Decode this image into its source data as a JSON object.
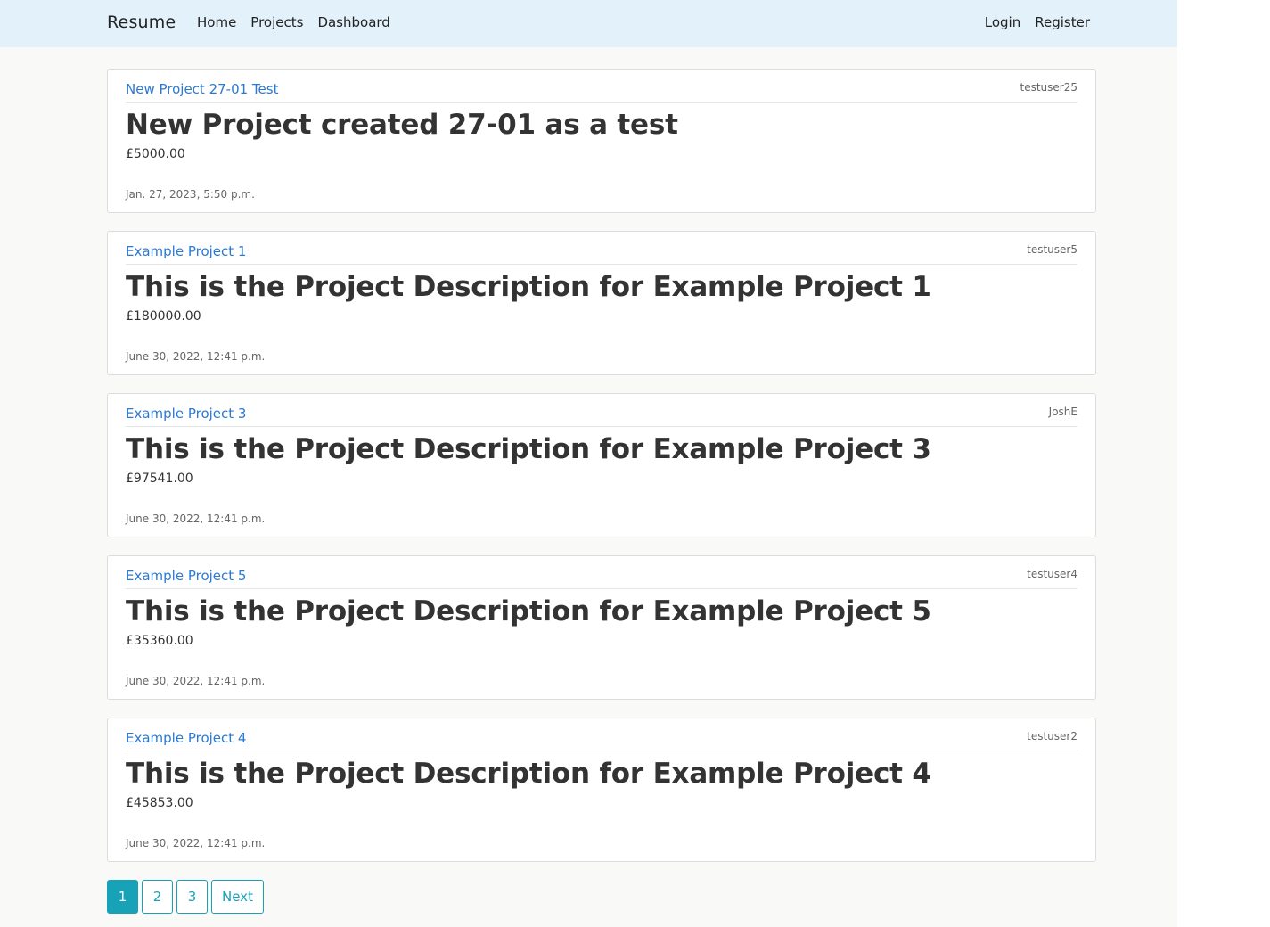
{
  "navbar": {
    "brand": "Resume",
    "left_links": [
      "Home",
      "Projects",
      "Dashboard"
    ],
    "right_links": [
      "Login",
      "Register"
    ]
  },
  "projects": [
    {
      "title": "New Project 27-01 Test",
      "user": "testuser25",
      "description": "New Project created 27-01 as a test",
      "price": "£5000.00",
      "date": "Jan. 27, 2023, 5:50 p.m."
    },
    {
      "title": "Example Project 1",
      "user": "testuser5",
      "description": "This is the Project Description for Example Project 1",
      "price": "£180000.00",
      "date": "June 30, 2022, 12:41 p.m."
    },
    {
      "title": "Example Project 3",
      "user": "JoshE",
      "description": "This is the Project Description for Example Project 3",
      "price": "£97541.00",
      "date": "June 30, 2022, 12:41 p.m."
    },
    {
      "title": "Example Project 5",
      "user": "testuser4",
      "description": "This is the Project Description for Example Project 5",
      "price": "£35360.00",
      "date": "June 30, 2022, 12:41 p.m."
    },
    {
      "title": "Example Project 4",
      "user": "testuser2",
      "description": "This is the Project Description for Example Project 4",
      "price": "£45853.00",
      "date": "June 30, 2022, 12:41 p.m."
    }
  ],
  "pagination": {
    "pages": [
      "1",
      "2",
      "3"
    ],
    "current": "1",
    "next_label": "Next"
  },
  "colors": {
    "navbar_bg": "#e3f1fb",
    "link": "#2a7ad4",
    "pagination_accent": "#17a2b8"
  }
}
